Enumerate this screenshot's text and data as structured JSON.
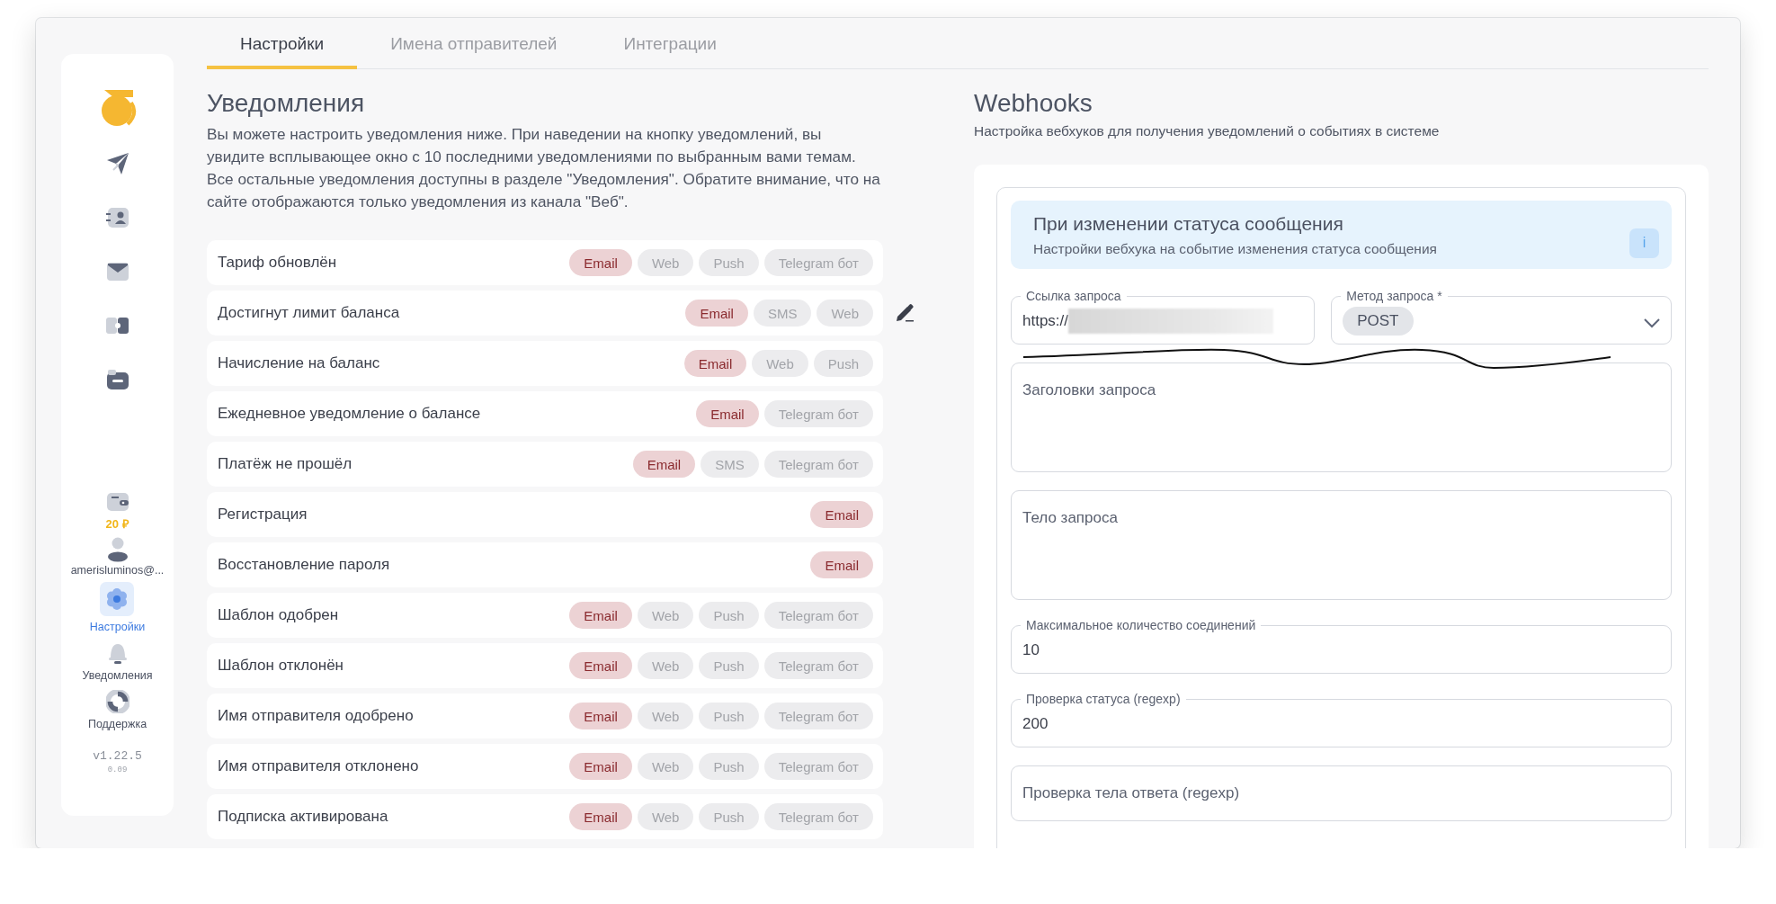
{
  "sidebar": {
    "balance": "20 ₽",
    "user": "amerisluminos@...",
    "items": [
      {
        "label": "Настройки",
        "selected": true
      },
      {
        "label": "Уведомления",
        "selected": false
      },
      {
        "label": "Поддержка",
        "selected": false
      }
    ],
    "version": "v1.22.5",
    "build": "0.09"
  },
  "tabs": [
    {
      "label": "Настройки",
      "selected": true
    },
    {
      "label": "Имена отправителей",
      "selected": false
    },
    {
      "label": "Интеграции",
      "selected": false
    }
  ],
  "notifications": {
    "title": "Уведомления",
    "description": "Вы можете настроить уведомления ниже. При наведении на кнопку уведомлений, вы увидите всплывающее окно с 10 последними уведомлениями по выбранным вами темам. Все остальные уведомления доступны в разделе \"Уведомления\". Обратите внимание, что на сайте отображаются только уведомления из канала \"Веб\".",
    "events": [
      {
        "name": "Тариф обновлён",
        "editable": false,
        "channels": [
          {
            "label": "Email",
            "on": true
          },
          {
            "label": "Web",
            "on": false
          },
          {
            "label": "Push",
            "on": false
          },
          {
            "label": "Telegram бот",
            "on": false
          }
        ]
      },
      {
        "name": "Достигнут лимит баланса",
        "editable": true,
        "channels": [
          {
            "label": "Email",
            "on": true
          },
          {
            "label": "SMS",
            "on": false
          },
          {
            "label": "Web",
            "on": false
          }
        ]
      },
      {
        "name": "Начисление на баланс",
        "editable": false,
        "channels": [
          {
            "label": "Email",
            "on": true
          },
          {
            "label": "Web",
            "on": false
          },
          {
            "label": "Push",
            "on": false
          }
        ]
      },
      {
        "name": "Ежедневное уведомление о балансе",
        "editable": false,
        "channels": [
          {
            "label": "Email",
            "on": true
          },
          {
            "label": "Telegram бот",
            "on": false
          }
        ]
      },
      {
        "name": "Платёж не прошёл",
        "editable": false,
        "channels": [
          {
            "label": "Email",
            "on": true
          },
          {
            "label": "SMS",
            "on": false
          },
          {
            "label": "Telegram бот",
            "on": false
          }
        ]
      },
      {
        "name": "Регистрация",
        "editable": false,
        "channels": [
          {
            "label": "Email",
            "on": true
          }
        ]
      },
      {
        "name": "Восстановление пароля",
        "editable": false,
        "channels": [
          {
            "label": "Email",
            "on": true
          }
        ]
      },
      {
        "name": "Шаблон одобрен",
        "editable": false,
        "channels": [
          {
            "label": "Email",
            "on": true
          },
          {
            "label": "Web",
            "on": false
          },
          {
            "label": "Push",
            "on": false
          },
          {
            "label": "Telegram бот",
            "on": false
          }
        ]
      },
      {
        "name": "Шаблон отклонён",
        "editable": false,
        "channels": [
          {
            "label": "Email",
            "on": true
          },
          {
            "label": "Web",
            "on": false
          },
          {
            "label": "Push",
            "on": false
          },
          {
            "label": "Telegram бот",
            "on": false
          }
        ]
      },
      {
        "name": "Имя отправителя одобрено",
        "editable": false,
        "channels": [
          {
            "label": "Email",
            "on": true
          },
          {
            "label": "Web",
            "on": false
          },
          {
            "label": "Push",
            "on": false
          },
          {
            "label": "Telegram бот",
            "on": false
          }
        ]
      },
      {
        "name": "Имя отправителя отклонено",
        "editable": false,
        "channels": [
          {
            "label": "Email",
            "on": true
          },
          {
            "label": "Web",
            "on": false
          },
          {
            "label": "Push",
            "on": false
          },
          {
            "label": "Telegram бот",
            "on": false
          }
        ]
      },
      {
        "name": "Подписка активирована",
        "editable": false,
        "channels": [
          {
            "label": "Email",
            "on": true
          },
          {
            "label": "Web",
            "on": false
          },
          {
            "label": "Push",
            "on": false
          },
          {
            "label": "Telegram бот",
            "on": false
          }
        ]
      }
    ]
  },
  "webhooks": {
    "title": "Webhooks",
    "subtitle": "Настройка вебхуков для получения уведомлений о событиях в системе",
    "card": {
      "title": "При изменении статуса сообщения",
      "subtitle": "Настройки вебхука на событие изменения статуса сообщения",
      "info": "i"
    },
    "fields": [
      {
        "kind": "url",
        "label": "Ссылка запроса",
        "value": "https://"
      },
      {
        "kind": "select",
        "label": "Метод запроса *",
        "value": "POST"
      },
      {
        "kind": "textarea",
        "placeholder": "Заголовки запроса"
      },
      {
        "kind": "textarea",
        "placeholder": "Тело запроса"
      },
      {
        "kind": "text",
        "label": "Максимальное количество соединений",
        "value": "10"
      },
      {
        "kind": "text",
        "label": "Проверка статуса (regexp)",
        "value": "200"
      },
      {
        "kind": "input",
        "placeholder": "Проверка тела ответа (regexp)"
      }
    ]
  }
}
